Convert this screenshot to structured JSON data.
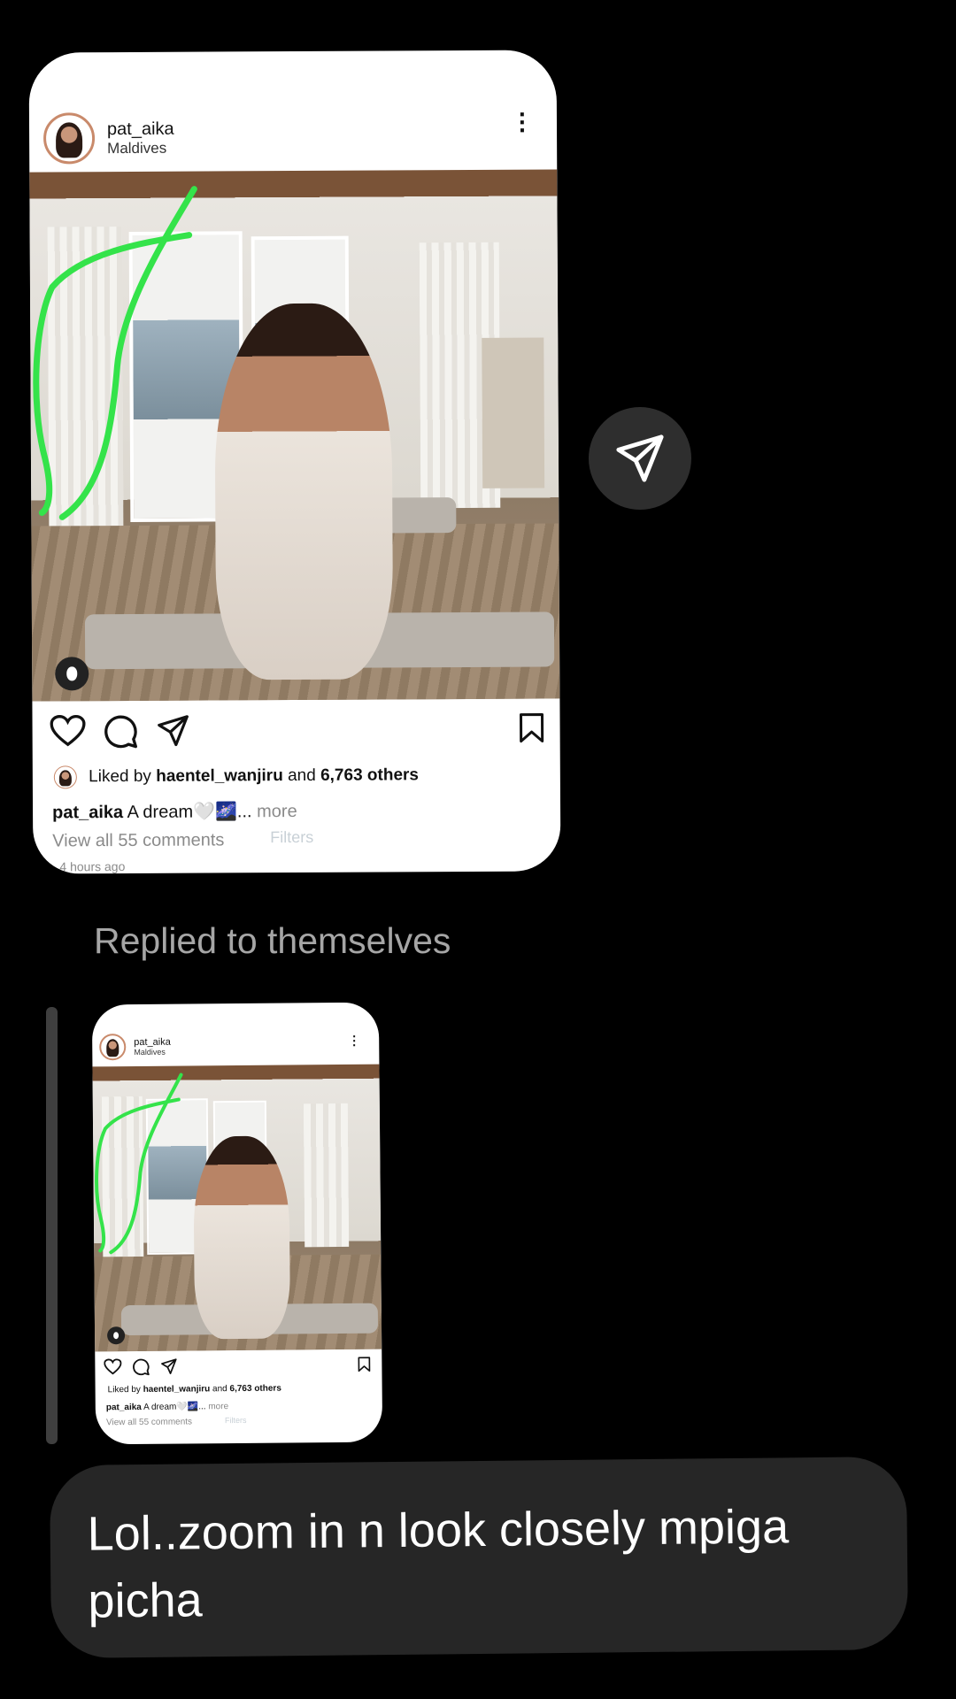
{
  "shared_post": {
    "username": "pat_aika",
    "location": "Maldives",
    "liked_by_prefix": "Liked by ",
    "liked_by_user": "haentel_wanjiru",
    "liked_by_and": " and ",
    "liked_by_count": "6,763 others",
    "caption_user": "pat_aika",
    "caption_text": " A dream🤍🌌... ",
    "caption_more": "more",
    "filters_label": "Filters",
    "view_comments": "View all 55 comments",
    "time_ago": "4 hours ago"
  },
  "replied_label": "Replied to themselves",
  "reply_post": {
    "username": "pat_aika",
    "location": "Maldives",
    "liked_line_prefix": "Liked by ",
    "liked_by_user": "haentel_wanjiru",
    "liked_by_and": " and ",
    "liked_by_count": "6,763 others",
    "caption_user": "pat_aika",
    "caption_text": " A dream🤍🌌... ",
    "caption_more": "more",
    "view_comments": "View all 55 comments",
    "filters_label": "Filters"
  },
  "message": "Lol..zoom in n look closely mpiga picha",
  "icons": [
    "heart-icon",
    "comment-icon",
    "share-icon",
    "bookmark-icon",
    "more-icon",
    "camera-user-icon",
    "send-icon"
  ],
  "colors": {
    "background": "#000000",
    "bubble": "#262626",
    "annotation": "#34e34a"
  }
}
